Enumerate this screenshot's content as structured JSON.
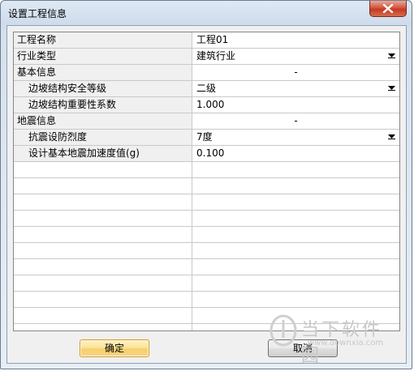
{
  "window": {
    "title": "设置工程信息"
  },
  "grid": {
    "rows": [
      {
        "name": "工程名称",
        "value": "工程01",
        "indent": false,
        "dropdown": false,
        "center": false
      },
      {
        "name": "行业类型",
        "value": "建筑行业",
        "indent": false,
        "dropdown": true,
        "center": false
      },
      {
        "name": "基本信息",
        "value": "-",
        "indent": false,
        "dropdown": false,
        "center": true
      },
      {
        "name": "边坡结构安全等级",
        "value": "二级",
        "indent": true,
        "dropdown": true,
        "center": false
      },
      {
        "name": "边坡结构重要性系数",
        "value": "1.000",
        "indent": true,
        "dropdown": false,
        "center": false
      },
      {
        "name": "地震信息",
        "value": "-",
        "indent": false,
        "dropdown": false,
        "center": true
      },
      {
        "name": "抗震设防烈度",
        "value": "7度",
        "indent": true,
        "dropdown": true,
        "center": false
      },
      {
        "name": "设计基本地震加速度值(g)",
        "value": "0.100",
        "indent": true,
        "dropdown": false,
        "center": false
      }
    ],
    "empty_row_count": 11
  },
  "buttons": {
    "ok_label": "确定",
    "cancel_label": "取消"
  },
  "watermark": {
    "main": "当下软件园",
    "url": "www.downxia.com"
  },
  "colors": {
    "title_gradient": "#cfdceb",
    "close_button": "#c23a22",
    "default_button": "#fbe39a",
    "name_column_bg": "#f0f0f0"
  }
}
